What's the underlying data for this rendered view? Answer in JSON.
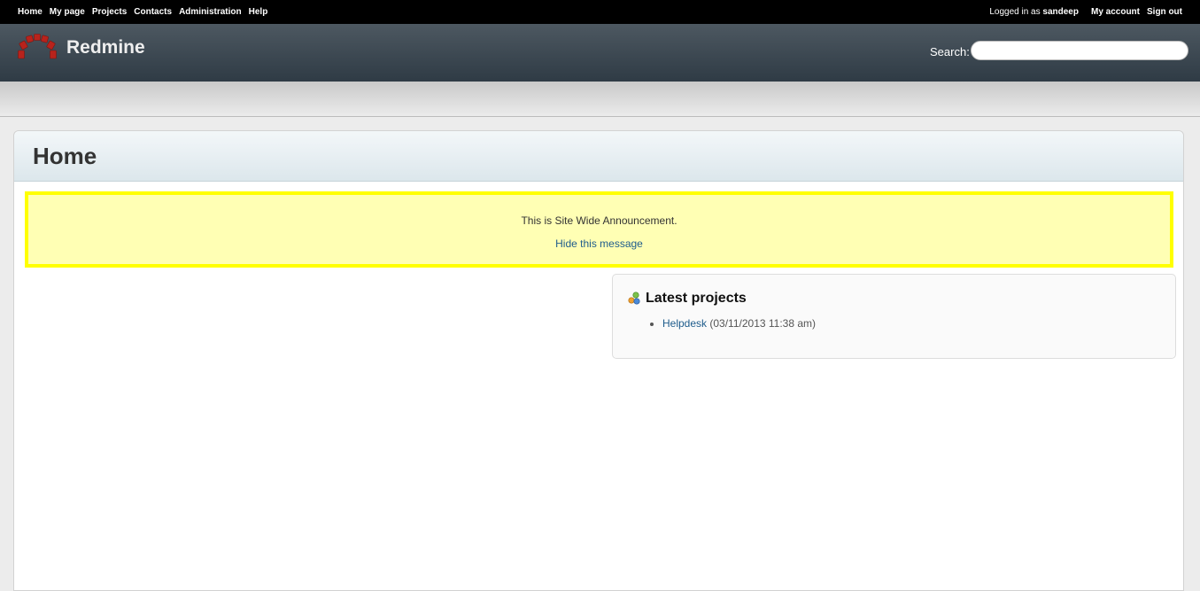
{
  "top_menu": {
    "items": [
      "Home",
      "My page",
      "Projects",
      "Contacts",
      "Administration",
      "Help"
    ],
    "logged_in_prefix": "Logged in as",
    "username": "sandeep",
    "my_account": "My account",
    "sign_out": "Sign out"
  },
  "header": {
    "title": "Redmine",
    "search_label": "Search:",
    "search_value": ""
  },
  "page": {
    "title": "Home"
  },
  "announcement": {
    "text": "This is Site Wide Announcement.",
    "hide_link": "Hide this message"
  },
  "latest_projects": {
    "heading": "Latest projects",
    "items": [
      {
        "name": "Helpdesk",
        "date": "(03/11/2013 11:38 am)"
      }
    ]
  },
  "colors": {
    "top_bar": "#000000",
    "header_bg": "#3e4a54",
    "announcement_bg": "#ffffb4",
    "announcement_border": "#ffff00",
    "link": "#1e5c8c"
  },
  "icons": {
    "logo": "redmine-logo",
    "projects": "projects-icon"
  }
}
